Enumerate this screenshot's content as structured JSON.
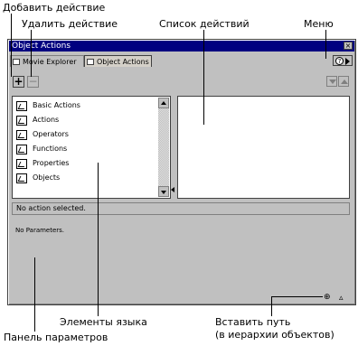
{
  "callouts": {
    "add_action": "Добавить действие",
    "delete_action": "Удалить действие",
    "action_list": "Список действий",
    "menu": "Меню",
    "language_elements": "Элементы языка",
    "parameters_panel": "Панель параметров",
    "insert_path_line1": "Вставить путь",
    "insert_path_line2": "(в иерархии объектов)"
  },
  "window": {
    "title": "Object Actions",
    "close_glyph": "×"
  },
  "tabs": [
    {
      "label": "Movie Explorer"
    },
    {
      "label": "Object Actions"
    }
  ],
  "toolbar": {
    "add_glyph": "+",
    "remove_glyph": "−"
  },
  "menu_button": {
    "help_glyph": "?"
  },
  "toolbox": {
    "items": [
      {
        "label": "Basic Actions",
        "icon": "book-icon"
      },
      {
        "label": "Actions",
        "icon": "book-icon"
      },
      {
        "label": "Operators",
        "icon": "book-icon"
      },
      {
        "label": "Functions",
        "icon": "book-icon"
      },
      {
        "label": "Properties",
        "icon": "book-icon"
      },
      {
        "label": "Objects",
        "icon": "book-icon"
      }
    ]
  },
  "status": {
    "text": "No action selected."
  },
  "parameters": {
    "text": "No Parameters."
  },
  "bottom_icons": {
    "target_glyph": "⊕",
    "expand_glyph": "▵"
  }
}
